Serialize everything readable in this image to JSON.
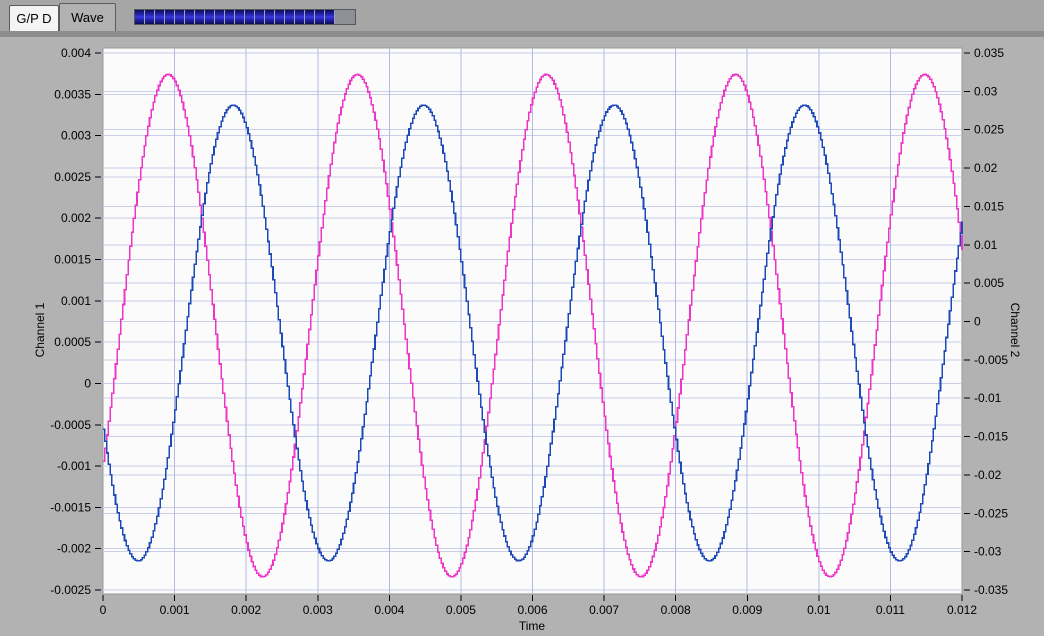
{
  "window": {
    "theme": {
      "panel_bg": "#b2b2b2",
      "header_bg": "#a6a6a6",
      "header_edge": "#8d8d8d",
      "plot_bg": "#fbfbfb",
      "plot_border": "#9a9a9a",
      "tick_color": "#000000"
    }
  },
  "tabs": [
    {
      "label": "G/P D",
      "selected": false
    },
    {
      "label": "Wave",
      "selected": true
    }
  ],
  "progress_bar": {
    "filled_segments": 20,
    "fill_percent": 90,
    "segment_dark": "#0b0b55",
    "segment_bright": "#3a3ae0",
    "empty_color": "#8f8f96"
  },
  "chart_data": {
    "type": "line",
    "title": "",
    "x_axis": {
      "label": "Time",
      "min": 0,
      "max": 0.012,
      "tick_step": 0.001,
      "tick_labels": [
        "0",
        "0.001",
        "0.002",
        "0.003",
        "0.004",
        "0.005",
        "0.006",
        "0.007",
        "0.008",
        "0.009",
        "0.01",
        "0.011",
        "0.012"
      ]
    },
    "y_axis_left": {
      "label": "Channel 1",
      "min": -0.0025,
      "max": 0.004,
      "tick_step": 0.0005,
      "tick_labels": [
        "0.004",
        "0.0035",
        "0.003",
        "0.0025",
        "0.002",
        "0.0015",
        "0.001",
        "0.0005",
        "0",
        "-0.0005",
        "-0.001",
        "-0.0015",
        "-0.002",
        "-0.0025"
      ]
    },
    "y_axis_right": {
      "label": "Channel 2",
      "min": -0.035,
      "max": 0.035,
      "tick_step": 0.005,
      "tick_labels": [
        "0.035",
        "0.03",
        "0.025",
        "0.02",
        "0.015",
        "0.01",
        "0.005",
        "0",
        "-0.005",
        "-0.01",
        "-0.015",
        "-0.02",
        "-0.025",
        "-0.03",
        "-0.035"
      ]
    },
    "grid": {
      "vertical": true,
      "horizontal": true,
      "vertical_color": "#b4b8e2",
      "horizontal_color": "#cbcee9"
    },
    "series": [
      {
        "name": "Channel 1",
        "axis": "left",
        "color": "#ee35c8",
        "waveform": {
          "shape": "sine",
          "amplitude": 0.00304,
          "dc_offset": 0.0007,
          "frequency_hz": 378.5,
          "first_peak_t": 0.0009,
          "observed_max": 0.00374,
          "observed_min": -0.00234
        }
      },
      {
        "name": "Channel 2",
        "axis": "right",
        "color": "#1e4ab8",
        "waveform": {
          "shape": "sine",
          "amplitude": 0.0297,
          "dc_offset": -0.0015,
          "frequency_hz": 376.0,
          "first_peak_t": 0.00181,
          "observed_max": 0.0296,
          "observed_min": -0.0322
        }
      }
    ]
  }
}
